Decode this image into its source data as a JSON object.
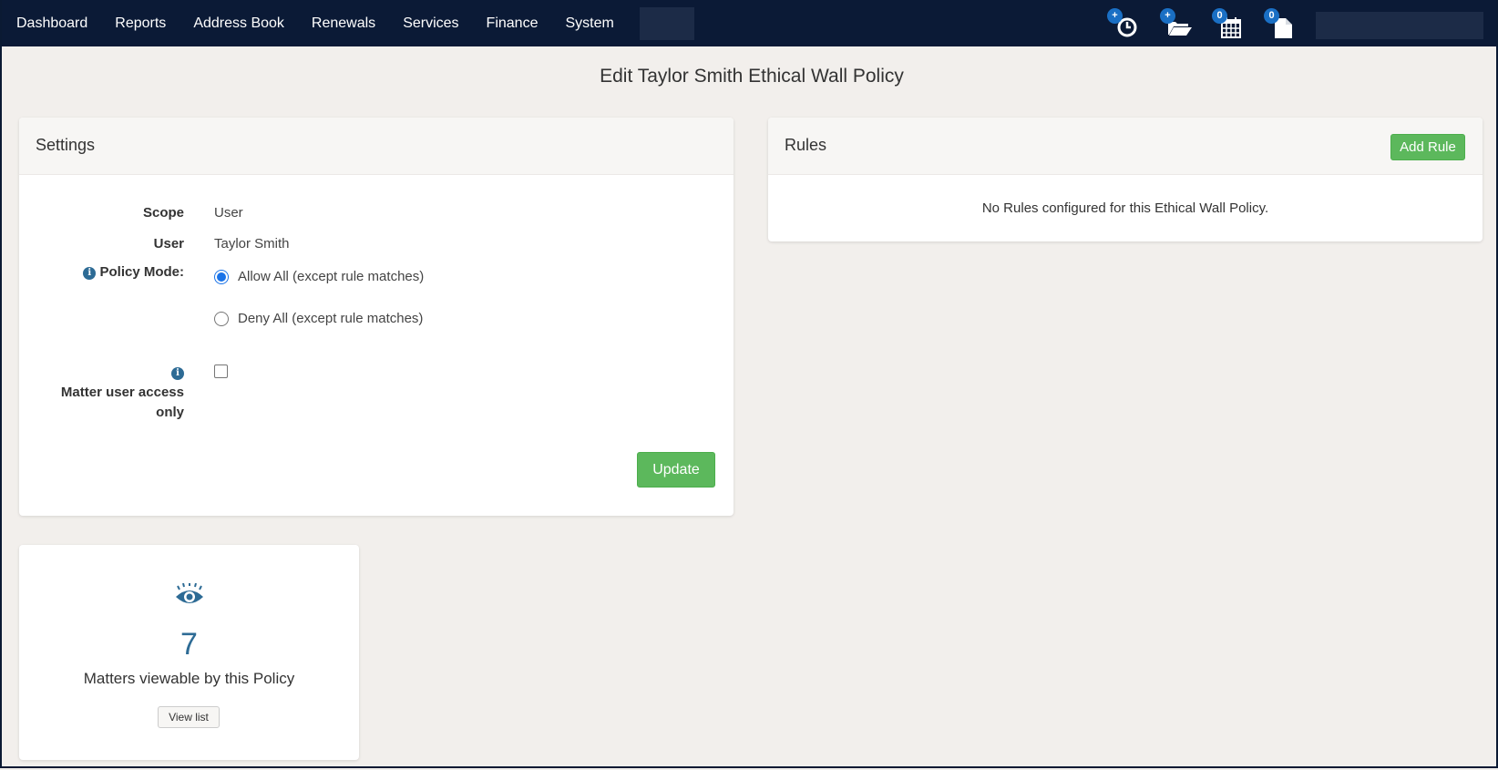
{
  "navbar": {
    "items": [
      "Dashboard",
      "Reports",
      "Address Book",
      "Renewals",
      "Services",
      "Finance",
      "System"
    ],
    "icons": [
      {
        "name": "timer-icon",
        "badge": "+"
      },
      {
        "name": "folder-open-icon",
        "badge": "+"
      },
      {
        "name": "calendar-icon",
        "badge": "0"
      },
      {
        "name": "document-icon",
        "badge": "0"
      }
    ]
  },
  "page": {
    "title": "Edit Taylor Smith Ethical Wall Policy"
  },
  "settings": {
    "title": "Settings",
    "scope_label": "Scope",
    "scope_value": "User",
    "user_label": "User",
    "user_value": "Taylor Smith",
    "policy_mode_label": "Policy Mode:",
    "policy_modes": [
      "Allow All (except rule matches)",
      "Deny All (except rule matches)"
    ],
    "policy_mode_selected": "Allow All (except rule matches)",
    "matter_access_label": "Matter user access only",
    "matter_access_checked": false,
    "update_label": "Update"
  },
  "rules": {
    "title": "Rules",
    "add_rule_label": "Add Rule",
    "empty_message": "No Rules configured for this Ethical Wall Policy."
  },
  "matters": {
    "count": "7",
    "label": "Matters viewable by this Policy",
    "view_list_label": "View list"
  },
  "colors": {
    "navbar": "#0b1a36",
    "accent_green": "#5cb85c",
    "accent_blue": "#2d6b95",
    "badge": "#1a6fc4"
  }
}
